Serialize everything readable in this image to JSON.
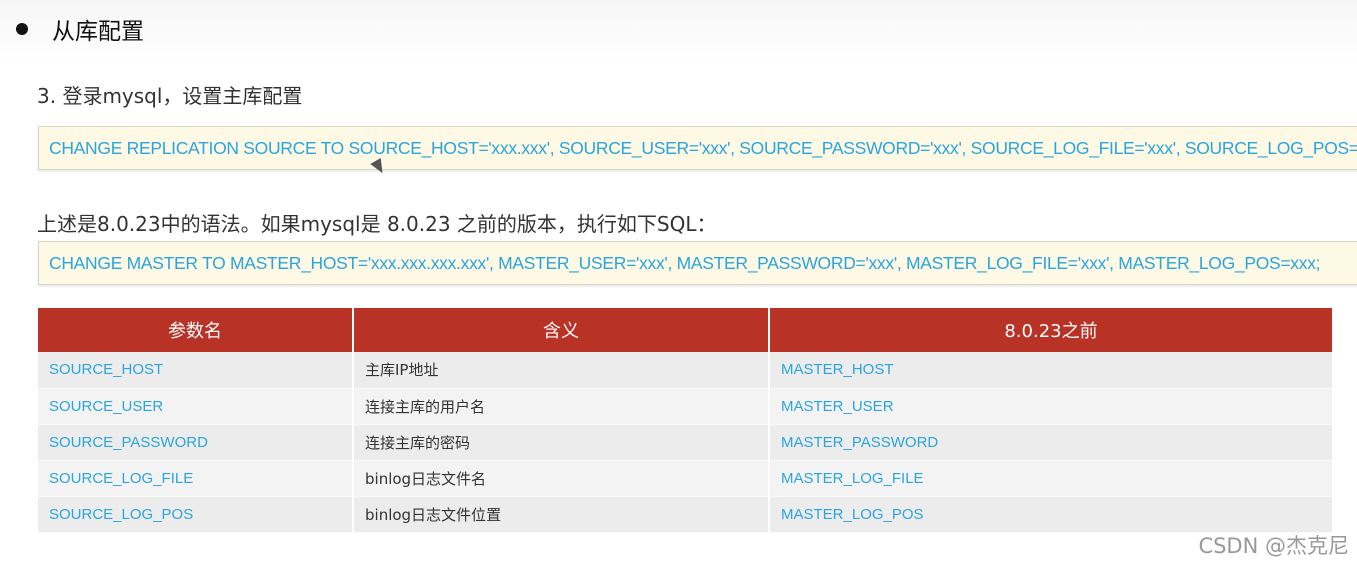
{
  "section": {
    "heading": "从库配置",
    "step": "3. 登录mysql，设置主库配置",
    "code_new": "CHANGE REPLICATION SOURCE TO SOURCE_HOST='xxx.xxx', SOURCE_USER='xxx', SOURCE_PASSWORD='xxx', SOURCE_LOG_FILE='xxx', SOURCE_LOG_POS=xxx;",
    "note": "上述是8.0.23中的语法。如果mysql是 8.0.23 之前的版本，执行如下SQL：",
    "code_old": "CHANGE MASTER TO MASTER_HOST='xxx.xxx.xxx.xxx', MASTER_USER='xxx', MASTER_PASSWORD='xxx', MASTER_LOG_FILE='xxx', MASTER_LOG_POS=xxx;"
  },
  "table": {
    "headers": [
      "参数名",
      "含义",
      "8.0.23之前"
    ],
    "rows": [
      [
        "SOURCE_HOST",
        "主库IP地址",
        "MASTER_HOST"
      ],
      [
        "SOURCE_USER",
        "连接主库的用户名",
        "MASTER_USER"
      ],
      [
        "SOURCE_PASSWORD",
        "连接主库的密码",
        "MASTER_PASSWORD"
      ],
      [
        "SOURCE_LOG_FILE",
        "binlog日志文件名",
        "MASTER_LOG_FILE"
      ],
      [
        "SOURCE_LOG_POS",
        "binlog日志文件位置",
        "MASTER_LOG_POS"
      ]
    ]
  },
  "watermark": "CSDN @杰克尼",
  "colors": {
    "header_bg": "#b83226",
    "code_text": "#2aa5dd",
    "code_bg": "#fdf9e4"
  }
}
